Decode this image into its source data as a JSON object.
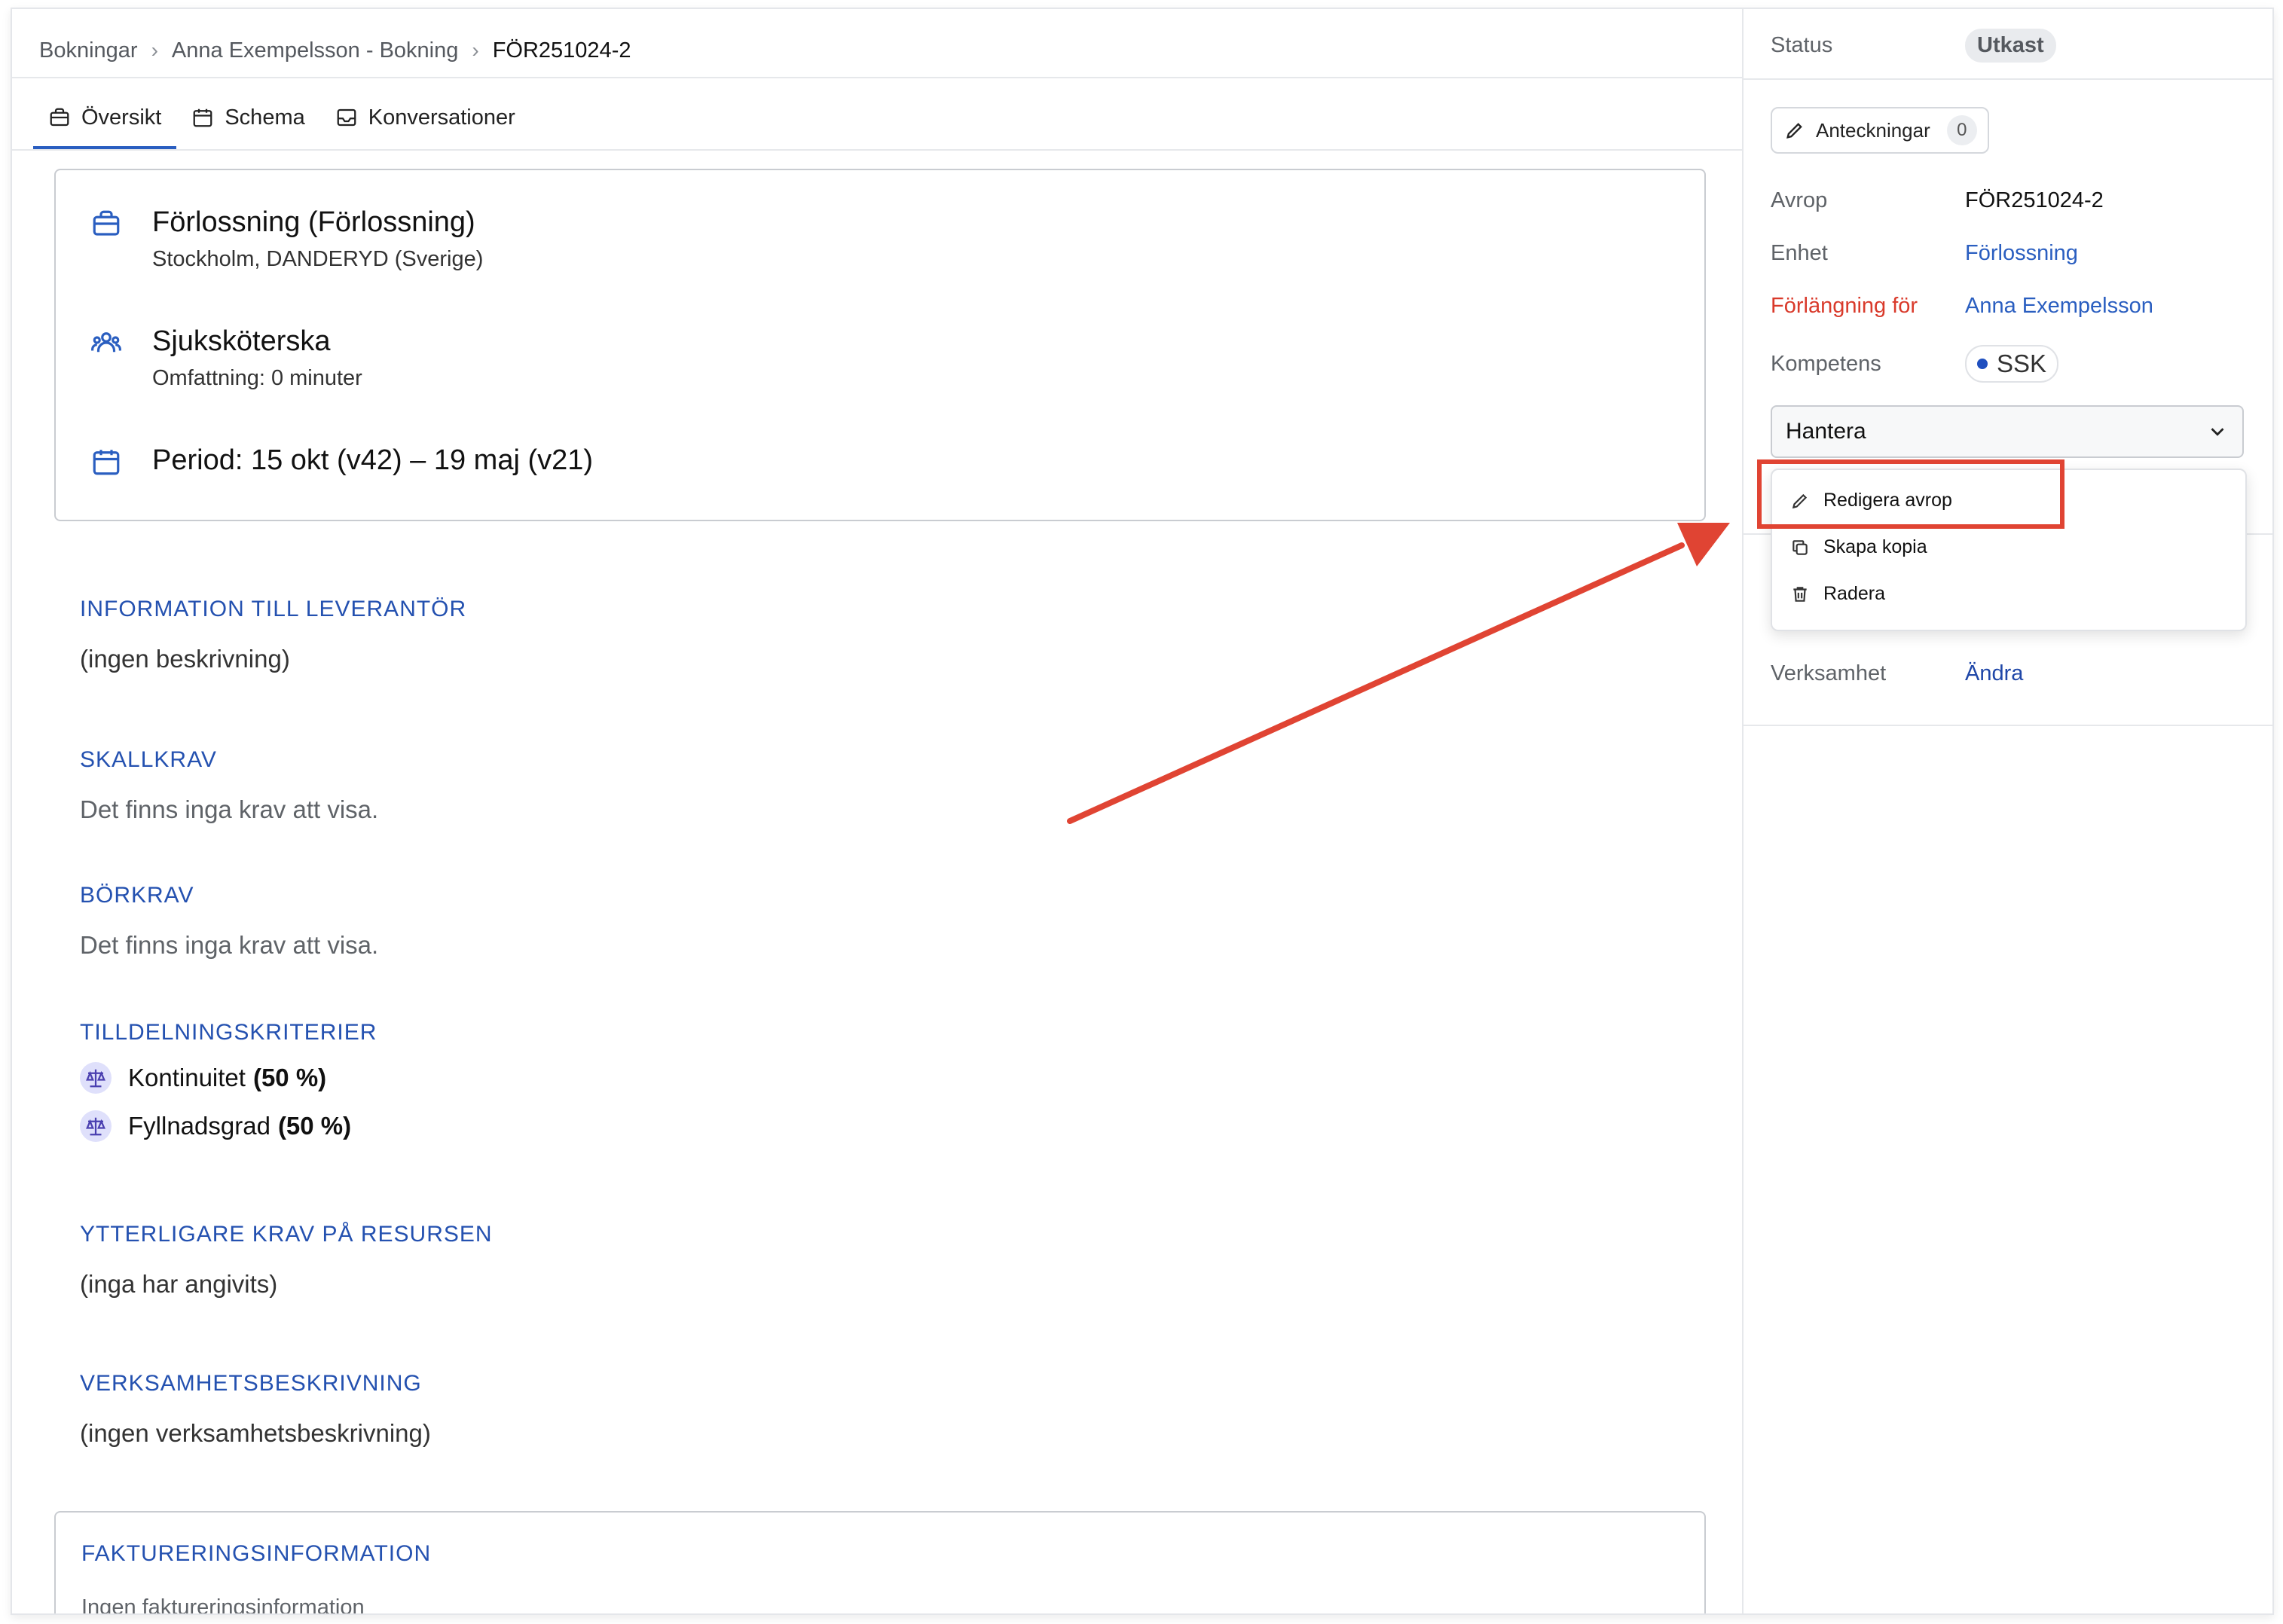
{
  "breadcrumb": {
    "items": [
      "Bokningar",
      "Anna Exempelsson - Bokning"
    ],
    "current": "FÖR251024-2"
  },
  "tabs": [
    {
      "label": "Översikt",
      "icon": "briefcase-icon"
    },
    {
      "label": "Schema",
      "icon": "calendar-icon"
    },
    {
      "label": "Konversationer",
      "icon": "inbox-icon"
    }
  ],
  "overview": {
    "unit_title": "Förlossning (Förlossning)",
    "unit_location": "Stockholm, DANDERYD (Sverige)",
    "role_title": "Sjuksköterska",
    "role_scope": "Omfattning: 0 minuter",
    "period": "Period: 15 okt (v42) – 19 maj (v21)"
  },
  "sections": {
    "info_title": "INFORMATION TILL LEVERANTÖR",
    "info_body": "(ingen beskrivning)",
    "skall_title": "SKALLKRAV",
    "skall_body": "Det finns inga krav att visa.",
    "bor_title": "BÖRKRAV",
    "bor_body": "Det finns inga krav att visa.",
    "criteria_title": "TILLDELNINGSKRITERIER",
    "criteria": [
      {
        "name": "Kontinuitet",
        "weight": "(50 %)"
      },
      {
        "name": "Fyllnadsgrad",
        "weight": "(50 %)"
      }
    ],
    "extra_title": "YTTERLIGARE KRAV PÅ RESURSEN",
    "extra_body": "(inga har angivits)",
    "business_title": "VERKSAMHETSBESKRIVNING",
    "business_body": "(ingen verksamhetsbeskrivning)",
    "billing_title": "FAKTURERINGSINFORMATION",
    "billing_body": "Ingen faktureringsinformation"
  },
  "panel": {
    "status_label": "Status",
    "status_value": "Utkast",
    "notes_label": "Anteckningar",
    "notes_count": "0",
    "avrop_label": "Avrop",
    "avrop_value": "FÖR251024-2",
    "enhet_label": "Enhet",
    "enhet_value": "Förlossning",
    "forlangning_label": "Förlängning för",
    "forlangning_value": "Anna Exempelsson",
    "kompetens_label": "Kompetens",
    "kompetens_value": "SSK",
    "hantera_label": "Hantera",
    "menu": {
      "edit": "Redigera avrop",
      "copy": "Skapa kopia",
      "delete": "Radera"
    },
    "verksamhet_label": "Verksamhet",
    "verksamhet_action": "Ändra"
  },
  "colors": {
    "accent": "#2a5ec0",
    "section_title": "#2451b0",
    "annotation": "#e04433",
    "red_label": "#d93a2b"
  }
}
